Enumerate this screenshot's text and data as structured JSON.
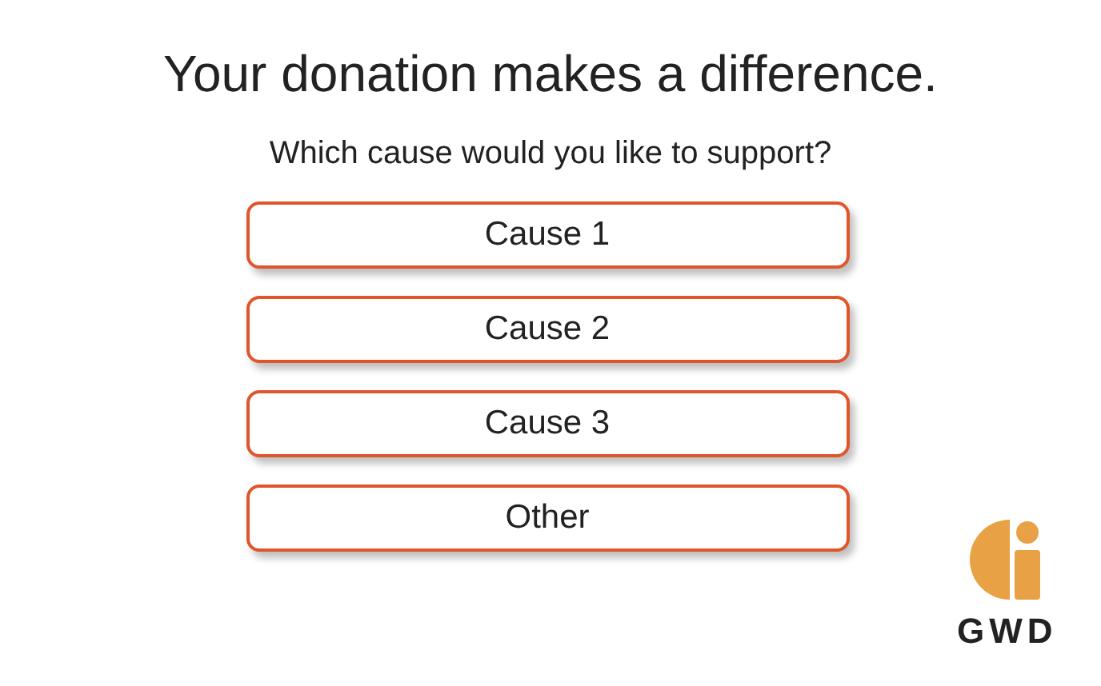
{
  "title": "Your donation makes a difference.",
  "question": "Which cause would you like to support?",
  "options": [
    {
      "label": "Cause 1"
    },
    {
      "label": "Cause 2"
    },
    {
      "label": "Cause 3"
    },
    {
      "label": "Other"
    }
  ],
  "logo": {
    "text": "GWD"
  }
}
